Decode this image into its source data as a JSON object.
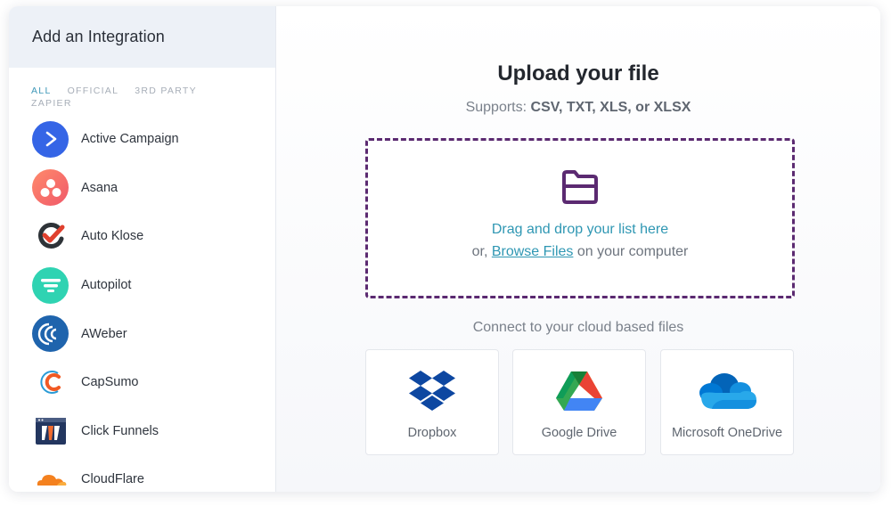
{
  "sidebar": {
    "title": "Add an Integration",
    "filters": [
      {
        "label": "ALL",
        "active": true
      },
      {
        "label": "OFFICIAL",
        "active": false
      },
      {
        "label": "3RD PARTY",
        "active": false
      },
      {
        "label": "ZAPIER",
        "active": false
      }
    ],
    "integrations": [
      {
        "name": "Active Campaign",
        "icon": "active-campaign-icon"
      },
      {
        "name": "Asana",
        "icon": "asana-icon"
      },
      {
        "name": "Auto Klose",
        "icon": "auto-klose-icon"
      },
      {
        "name": "Autopilot",
        "icon": "autopilot-icon"
      },
      {
        "name": "AWeber",
        "icon": "aweber-icon"
      },
      {
        "name": "CapSumo",
        "icon": "capsumo-icon"
      },
      {
        "name": "Click Funnels",
        "icon": "click-funnels-icon"
      },
      {
        "name": "CloudFlare",
        "icon": "cloudflare-icon"
      }
    ]
  },
  "upload": {
    "title": "Upload your file",
    "supports_prefix": "Supports: ",
    "supports_formats": "CSV, TXT, XLS, or XLSX",
    "drag_text": "Drag and drop your list here",
    "browse_prefix": "or, ",
    "browse_link": "Browse Files",
    "browse_suffix": " on your computer",
    "dropzone_color": "#5b2a71",
    "link_color": "#2f97b3"
  },
  "cloud": {
    "label": "Connect to your cloud based files",
    "providers": [
      {
        "name": "Dropbox",
        "icon": "dropbox-icon"
      },
      {
        "name": "Google Drive",
        "icon": "google-drive-icon"
      },
      {
        "name": "Microsoft OneDrive",
        "icon": "onedrive-icon"
      }
    ]
  }
}
